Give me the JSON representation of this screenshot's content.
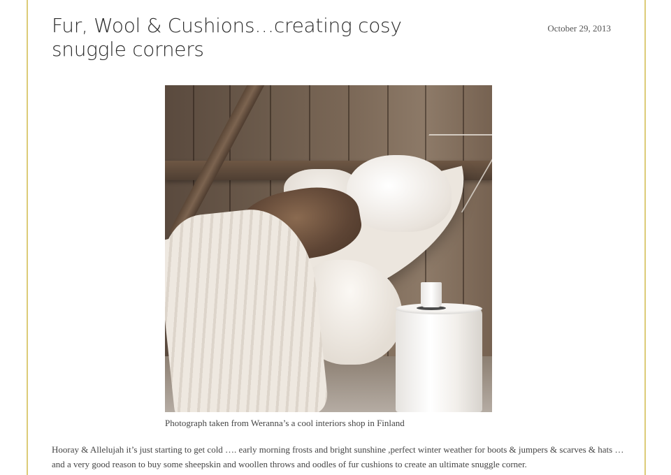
{
  "post": {
    "title": "Fur, Wool & Cushions…creating cosy snuggle corners",
    "date": "October 29, 2013",
    "image_caption": "Photograph taken from Weranna’s a cool interiors shop in Finland",
    "paragraph": "Hooray & Allelujah it’s just starting to get cold …. early morning frosts and bright sunshine ,perfect winter weather for boots & jumpers & scarves & hats … and a very good reason to buy some sheepskin and woollen throws and oodles of fur cushions to create an ultimate snuggle corner."
  },
  "colors": {
    "frame_border": "#dccb78",
    "title_text": "#2b2b2b",
    "body_text": "#444444"
  }
}
